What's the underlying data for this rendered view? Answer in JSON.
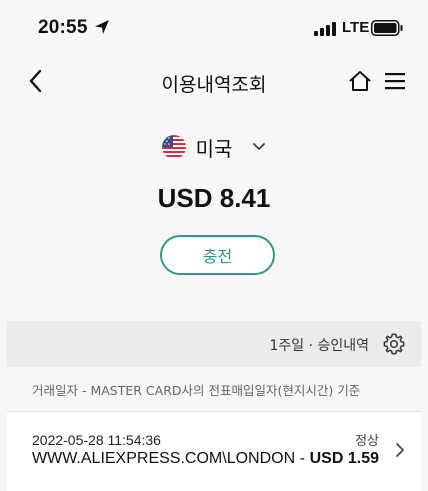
{
  "status_bar": {
    "time": "20:55",
    "network": "LTE",
    "icons": [
      "location-arrow-icon",
      "signal-icon",
      "battery-icon"
    ]
  },
  "nav": {
    "title": "이용내역조회",
    "icons": [
      "back-icon",
      "home-icon",
      "menu-icon"
    ]
  },
  "account": {
    "country": "미국",
    "flag_icon": "us-flag-icon",
    "balance": "USD 8.41",
    "charge_label": "충전"
  },
  "filter": {
    "label": "1주일 · 승인내역",
    "settings_icon": "gear-icon"
  },
  "note": "거래일자 - MASTER CARD사의 전표매입일자(현지시간) 기준",
  "transactions": [
    {
      "datetime": "2022-05-28 11:54:36",
      "status": "정상",
      "merchant": "WWW.ALIEXPRESS.COM\\LONDON - ",
      "amount": "USD 1.59"
    }
  ],
  "colors": {
    "accent": "#2f9a85",
    "background": "#f7f7f7",
    "filter_bar": "#ebebeb"
  }
}
